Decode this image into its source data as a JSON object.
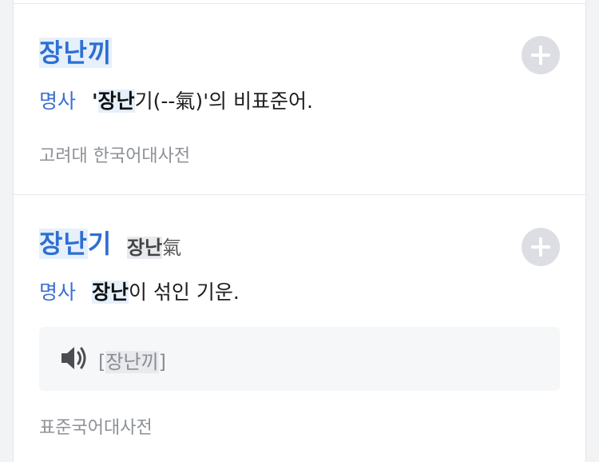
{
  "entries": [
    {
      "headword": "장난끼",
      "hanja_highlight": "",
      "hanja_rest": "",
      "pos": "명사",
      "def_prefix": "'",
      "def_keyword": "장난",
      "def_rest": "기(--氣)'의 비표준어.",
      "source": "고려대 한국어대사전",
      "add_icon": "plus-icon"
    },
    {
      "headword_highlight": "장난",
      "headword_rest": "기",
      "hanja_highlight": "장난",
      "hanja_rest": "氣",
      "pos": "명사",
      "def_keyword": "장난",
      "def_rest": "이 섞인 기운.",
      "pronunciation_open": "[",
      "pronunciation_highlight": "장난끼",
      "pronunciation_close": "]",
      "speaker_icon": "speaker-icon",
      "source": "표준국어대사전",
      "add_icon": "plus-icon"
    }
  ],
  "colors": {
    "headword": "#2e6fd1",
    "pos": "#3b6fd0",
    "highlight": "#e6f0fb",
    "source": "#8d9096",
    "button_bg": "#dcdee3"
  }
}
